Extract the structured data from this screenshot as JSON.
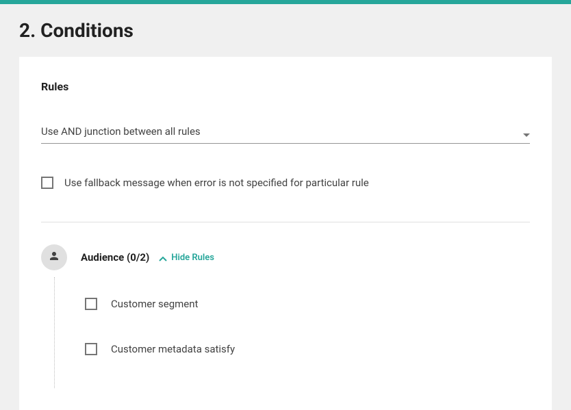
{
  "section": {
    "title": "2. Conditions"
  },
  "panel": {
    "title": "Rules",
    "junction_select": {
      "value": "Use AND junction between all rules"
    },
    "fallback_checkbox": {
      "label": "Use fallback message when error is not specified for particular rule"
    },
    "audience": {
      "title": "Audience (0/2)",
      "toggle_label": "Hide Rules",
      "rules": [
        {
          "label": "Customer segment"
        },
        {
          "label": "Customer metadata satisfy"
        }
      ]
    }
  }
}
